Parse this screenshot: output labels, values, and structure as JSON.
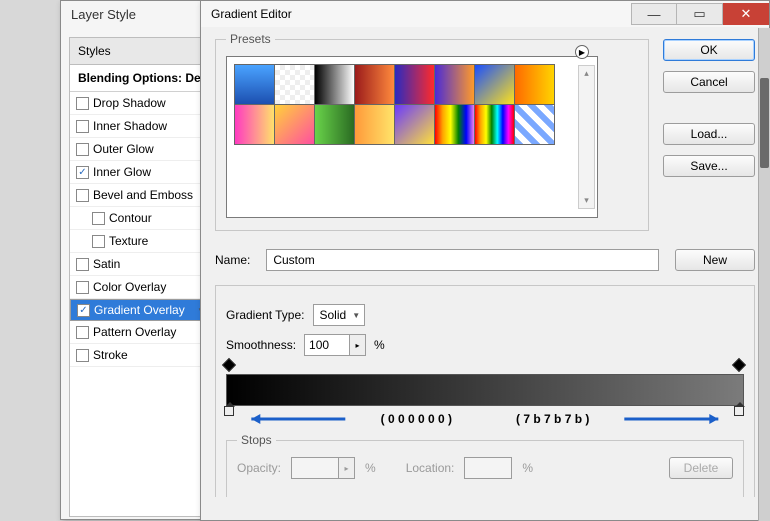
{
  "layer_style": {
    "title": "Layer Style",
    "styles_header": "Styles",
    "blending_options": "Blending Options: Default",
    "items": [
      {
        "label": "Drop Shadow",
        "checked": false,
        "sub": false,
        "sel": false
      },
      {
        "label": "Inner Shadow",
        "checked": false,
        "sub": false,
        "sel": false
      },
      {
        "label": "Outer Glow",
        "checked": false,
        "sub": false,
        "sel": false
      },
      {
        "label": "Inner Glow",
        "checked": true,
        "sub": false,
        "sel": false
      },
      {
        "label": "Bevel and Emboss",
        "checked": false,
        "sub": false,
        "sel": false
      },
      {
        "label": "Contour",
        "checked": false,
        "sub": true,
        "sel": false
      },
      {
        "label": "Texture",
        "checked": false,
        "sub": true,
        "sel": false
      },
      {
        "label": "Satin",
        "checked": false,
        "sub": false,
        "sel": false
      },
      {
        "label": "Color Overlay",
        "checked": false,
        "sub": false,
        "sel": false
      },
      {
        "label": "Gradient Overlay",
        "checked": true,
        "sub": false,
        "sel": true
      },
      {
        "label": "Pattern Overlay",
        "checked": false,
        "sub": false,
        "sel": false
      },
      {
        "label": "Stroke",
        "checked": false,
        "sub": false,
        "sel": false
      }
    ]
  },
  "gradient_editor": {
    "title": "Gradient Editor",
    "buttons": {
      "ok": "OK",
      "cancel": "Cancel",
      "load": "Load...",
      "save": "Save...",
      "new": "New",
      "delete": "Delete"
    },
    "presets_label": "Presets",
    "name_label": "Name:",
    "name_value": "Custom",
    "gradient_type_label": "Gradient Type:",
    "gradient_type_value": "Solid",
    "smoothness_label": "Smoothness:",
    "smoothness_value": "100",
    "percent": "%",
    "stops_label": "Stops",
    "opacity_label": "Opacity:",
    "location_label": "Location:",
    "swatches": [
      "linear-gradient(#4aa3ff,#1c4fb0)",
      "linear-gradient(45deg,#eee 25%,transparent 25%),linear-gradient(-45deg,#eee 25%,transparent 25%),linear-gradient(45deg,transparent 75%,#eee 75%),linear-gradient(-45deg,transparent 75%,#eee 75%)",
      "linear-gradient(90deg,#000,#fff)",
      "linear-gradient(90deg,#9b1b1b,#ff8a3d)",
      "linear-gradient(90deg,#2a2ac0,#ff2a2a)",
      "linear-gradient(90deg,#4a2bd6,#ff9a2a)",
      "linear-gradient(135deg,#1a4fff,#ffe21a)",
      "linear-gradient(90deg,#ff6a00,#ffd400)",
      "linear-gradient(90deg,#ff3ac0,#ffe16b)",
      "linear-gradient(135deg,#ffd13a,#ff4fa0)",
      "linear-gradient(90deg,#69d34a,#2a6b22)",
      "linear-gradient(90deg,#ff9a3a,#ffe46a)",
      "linear-gradient(135deg,#6a3aff,#ffe03a)",
      "linear-gradient(90deg,red,orange,yellow,green,blue,violet)",
      "linear-gradient(90deg,red,orange,yellow,green,cyan,blue,magenta,red)",
      "repeating-linear-gradient(45deg,#7aa8ff 0 6px,#fff 6px 12px)"
    ],
    "annotation": {
      "left": "( 0 0 0 0 0 0 )",
      "right": "( 7 b 7 b 7 b )"
    }
  }
}
